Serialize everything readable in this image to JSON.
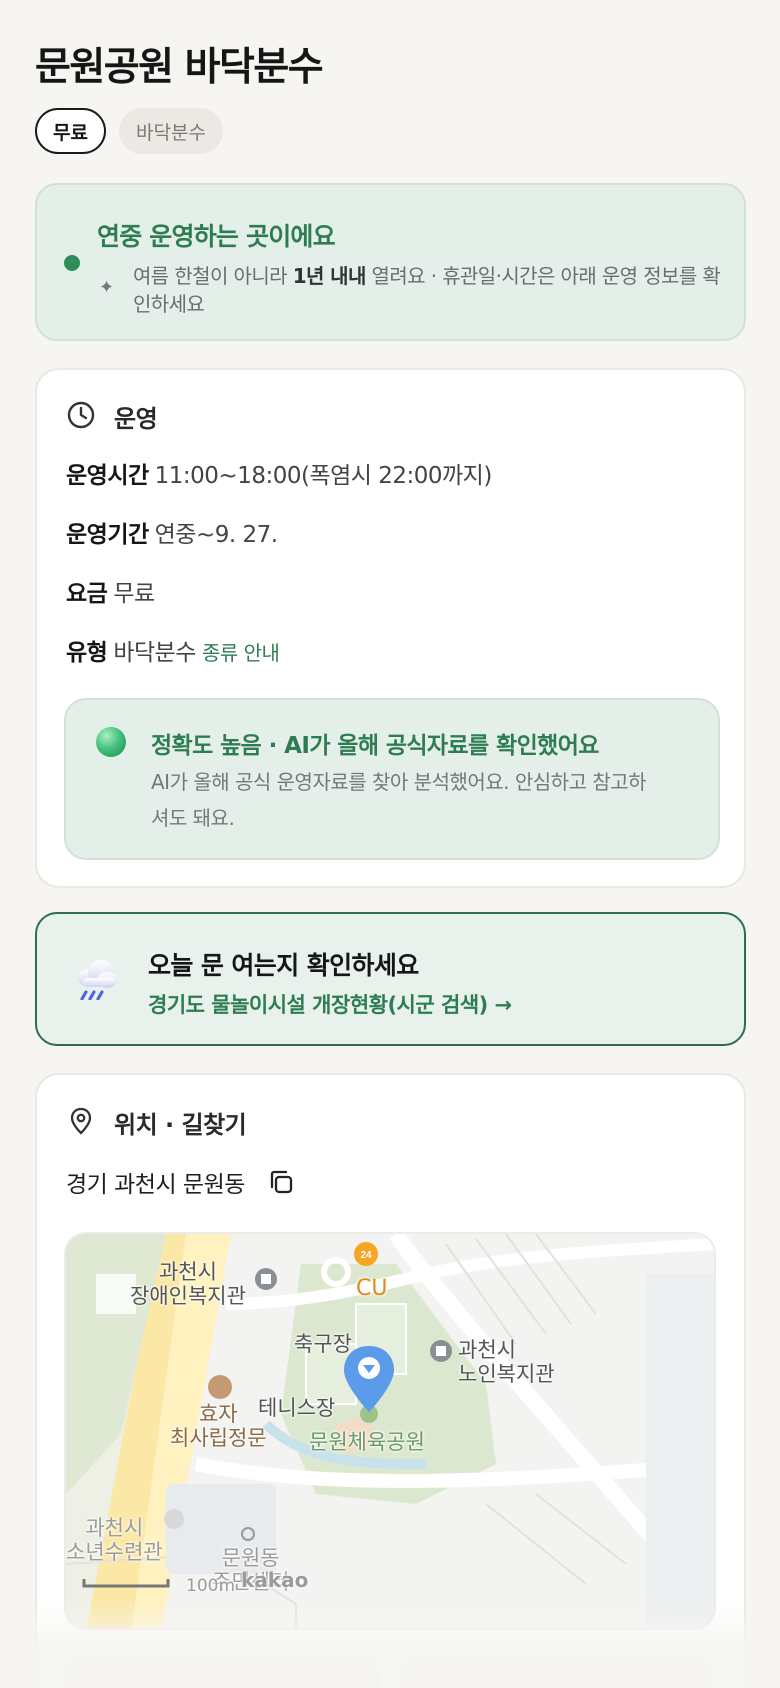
{
  "page": {
    "title": "문원공원 바닥분수",
    "chips": {
      "price": "무료",
      "type": "바닥분수"
    }
  },
  "banner": {
    "title": "연중 운영하는 곳이에요",
    "spark": "✦",
    "desc_pre": "여름 한철이 아니라 ",
    "desc_bold": "1년 내내",
    "desc_post": " 열려요 · 휴관일·시간은 아래 운영 정보를 확인하세요"
  },
  "operation": {
    "header": "운영",
    "rows": {
      "hours": {
        "key": "운영시간",
        "value": "11:00~18:00(폭염시 22:00까지)"
      },
      "period": {
        "key": "운영기간",
        "value": "연중~9. 27."
      },
      "fee": {
        "key": "요금",
        "value": "무료"
      },
      "type": {
        "key": "유형",
        "value": "바닥분수",
        "link": "종류 안내"
      }
    },
    "accuracy": {
      "title": "정확도 높음 · AI가 올해 공식자료를 확인했어요",
      "desc": "AI가 올해 공식 운영자료를 찾아 분석했어요. 안심하고 참고하셔도 돼요."
    }
  },
  "today": {
    "title": "오늘 문 여는지 확인하세요",
    "link": "경기도 물놀이시설 개장현황(시군 검색) →"
  },
  "location": {
    "header": "위치 · 길찾기",
    "address": "경기 과천시 문원동",
    "map": {
      "labels": {
        "disabled_center": "과천시\n장애인복지관",
        "cu": "CU",
        "cu_badge": "24",
        "soccer": "축구장",
        "senior_center": "과천시\n노인복지관",
        "hyoja": "효자\n최사립정문",
        "tennis": "테니스장",
        "park": "문원체육공원",
        "youth": "과천시\n소년수련관",
        "munwon": "문원동\n주민센터",
        "scale": "100m",
        "logo": "kakao"
      }
    }
  },
  "colors": {
    "accent_green": "#2e7d52",
    "banner_bg": "#e5efe9",
    "pin_blue": "#5b9bea"
  }
}
